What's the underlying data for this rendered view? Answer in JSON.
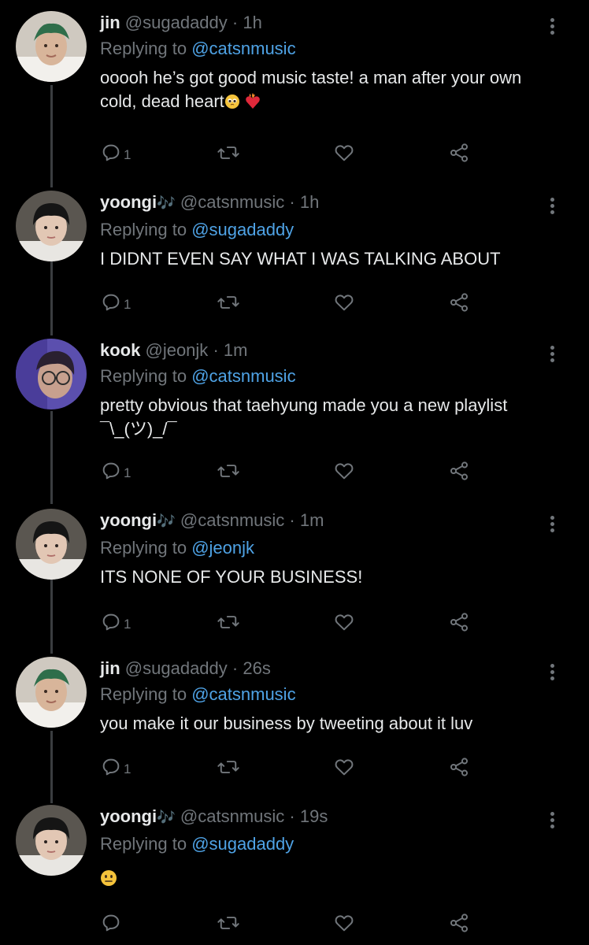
{
  "tweets": [
    {
      "name": "jin",
      "name_note": "",
      "handle": "@sugadaddy",
      "time": "1h",
      "replying_prefix": "Replying to",
      "replying_to": "@catsnmusic",
      "text": "ooooh he’s got good music taste! a man after your own cold, dead heart",
      "text_emojis": [
        "pleading-face-emoji",
        "heart-on-fire-emoji"
      ],
      "reply_count": "1",
      "avatar": "jin"
    },
    {
      "name": "yoongi",
      "name_note": "🎶",
      "handle": "@catsnmusic",
      "time": "1h",
      "replying_prefix": "Replying to",
      "replying_to": "@sugadaddy",
      "text": "I DIDNT EVEN SAY WHAT I WAS TALKING ABOUT",
      "text_emojis": [],
      "reply_count": "1",
      "avatar": "yoongi"
    },
    {
      "name": "kook",
      "name_note": "",
      "handle": "@jeonjk",
      "time": "1m",
      "replying_prefix": "Replying to",
      "replying_to": "@catsnmusic",
      "text": "pretty obvious that taehyung made you a new playlist ¯\\_(ツ)_/¯",
      "text_emojis": [],
      "reply_count": "1",
      "avatar": "kook"
    },
    {
      "name": "yoongi",
      "name_note": "🎶",
      "handle": "@catsnmusic",
      "time": "1m",
      "replying_prefix": "Replying to",
      "replying_to": "@jeonjk",
      "text": "ITS NONE OF YOUR BUSINESS!",
      "text_emojis": [],
      "reply_count": "1",
      "avatar": "yoongi"
    },
    {
      "name": "jin",
      "name_note": "",
      "handle": "@sugadaddy",
      "time": "26s",
      "replying_prefix": "Replying to",
      "replying_to": "@catsnmusic",
      "text": "you make it our business by tweeting about it luv",
      "text_emojis": [],
      "reply_count": "1",
      "avatar": "jin"
    },
    {
      "name": "yoongi",
      "name_note": "🎶",
      "handle": "@catsnmusic",
      "time": "19s",
      "replying_prefix": "Replying to",
      "replying_to": "@sugadaddy",
      "text": "",
      "text_emojis": [
        "neutral-face-emoji"
      ],
      "reply_count": "",
      "avatar": "yoongi"
    }
  ],
  "separator": "·",
  "icons": {
    "reply": "reply-icon",
    "retweet": "retweet-icon",
    "like": "like-icon",
    "share": "share-icon",
    "more": "more-vertical-icon"
  },
  "colors": {
    "background": "#000000",
    "text": "#e7e9ea",
    "muted": "#71767b",
    "link": "#4fa3e6",
    "thread_line": "#3a3d40"
  }
}
